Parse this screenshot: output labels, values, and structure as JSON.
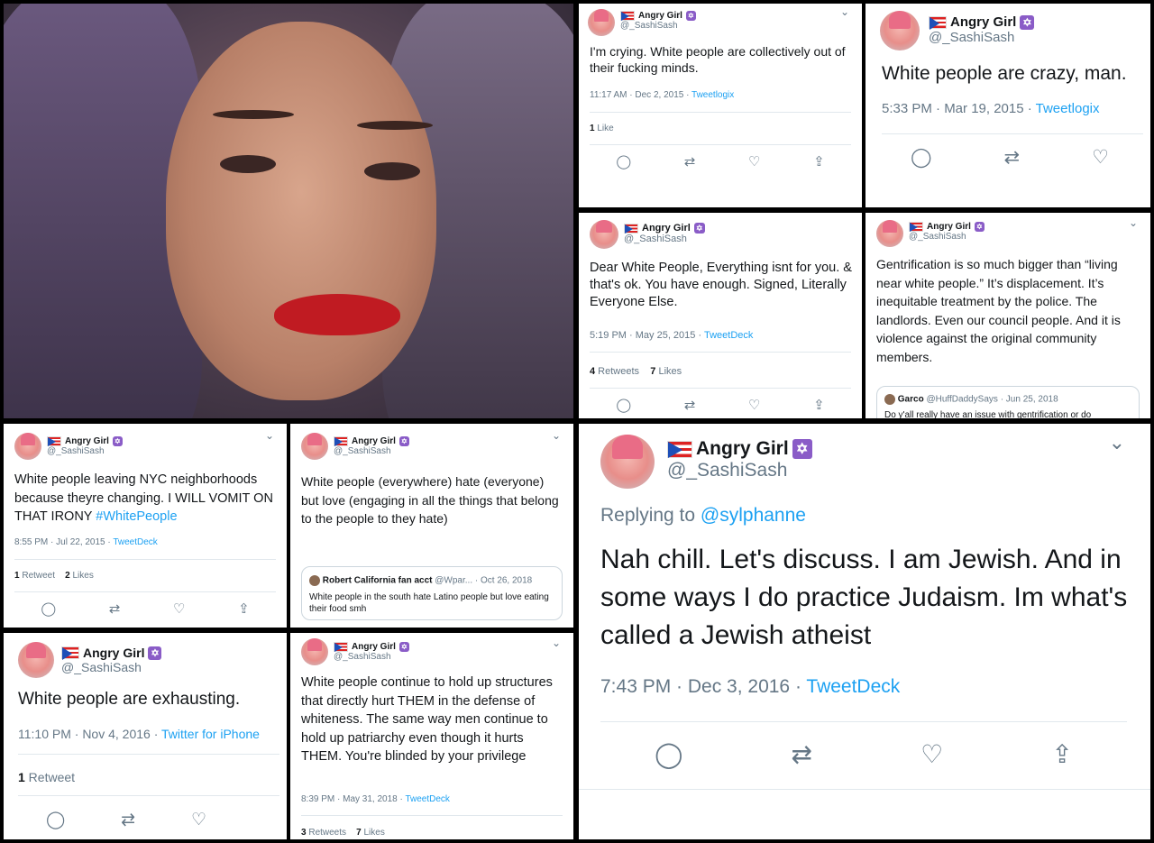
{
  "profile": {
    "name": "Angry Girl",
    "handle": "@_SashiSash"
  },
  "tweets": {
    "t1": {
      "text": "I'm crying. White people are collectively out of their fucking minds.",
      "time": "11:17 AM · Dec 2, 2015 · ",
      "source": "Tweetlogix",
      "likes_n": "1",
      "likes_l": " Like"
    },
    "t2": {
      "text": "White people are crazy, man.",
      "time": "5:33 PM · Mar 19, 2015 · ",
      "source": "Tweetlogix"
    },
    "t3": {
      "text": "Dear White People, Everything isnt for you. & that's ok. You have enough. Signed, Literally Everyone Else.",
      "time": "5:19 PM · May 25, 2015 · ",
      "source": "TweetDeck",
      "rt_n": "4",
      "rt_l": " Retweets",
      "likes_n": "7",
      "likes_l": " Likes"
    },
    "t4": {
      "text": "Gentrification is so much bigger than “living near white people.” It’s displacement. It’s inequitable treatment by the police. The landlords. Even our council people. And it is violence against the original community members.",
      "quote": {
        "name": "Garco",
        "handle": "@HuffDaddySays · Jun 25, 2018",
        "text": "Do y'all really have an issue with gentrification or do"
      }
    },
    "t5": {
      "text": "White people leaving NYC neighborhoods because theyre changing. I WILL VOMIT ON THAT IRONY ",
      "hashtag": "#WhitePeople",
      "time": "8:55 PM · Jul 22, 2015 · ",
      "source": "TweetDeck",
      "rt_n": "1",
      "rt_l": " Retweet",
      "likes_n": "2",
      "likes_l": " Likes"
    },
    "t6": {
      "text": "White people (everywhere) hate (everyone) but love (engaging in all the things that belong to the people to they hate)",
      "quote": {
        "name": "Robert California fan acct",
        "handle": "@Wpar... · Oct 26, 2018",
        "text": "White people in the south hate Latino people but love eating their food smh"
      }
    },
    "t7": {
      "reply_label": "Replying to ",
      "reply_to": "@sylphanne",
      "text": "Nah chill. Let's discuss. I am Jewish. And in some ways I do practice Judaism. Im what's called a Jewish atheist",
      "time": "7:43 PM · Dec 3, 2016 · ",
      "source": "TweetDeck"
    },
    "t8": {
      "text": "White people are exhausting.",
      "time": "11:10 PM · Nov 4, 2016 · ",
      "source": "Twitter for iPhone",
      "rt_n": "1",
      "rt_l": " Retweet"
    },
    "t9": {
      "text": "White people continue to hold up structures that directly hurt THEM in the defense of whiteness. The same way men continue to hold up patriarchy even though it hurts THEM. You're blinded by your privilege",
      "time": "8:39 PM · May 31, 2018 · ",
      "source": "TweetDeck",
      "rt_n": "3",
      "rt_l": " Retweets",
      "likes_n": "7",
      "likes_l": " Likes"
    }
  },
  "icons": {
    "reply": "reply-icon",
    "retweet": "retweet-icon",
    "like": "heart-icon",
    "share": "share-icon",
    "chevron": "chevron-down-icon",
    "flag": "puerto-rico-flag-icon",
    "star": "star-of-david-icon"
  },
  "glyphs": {
    "reply": "◯",
    "retweet": "⇄",
    "like": "♡",
    "share": "⇪",
    "chevron": "⌄",
    "star": "✡"
  },
  "colors": {
    "link": "#1da1f2",
    "muted": "#657786",
    "text": "#14171a"
  }
}
